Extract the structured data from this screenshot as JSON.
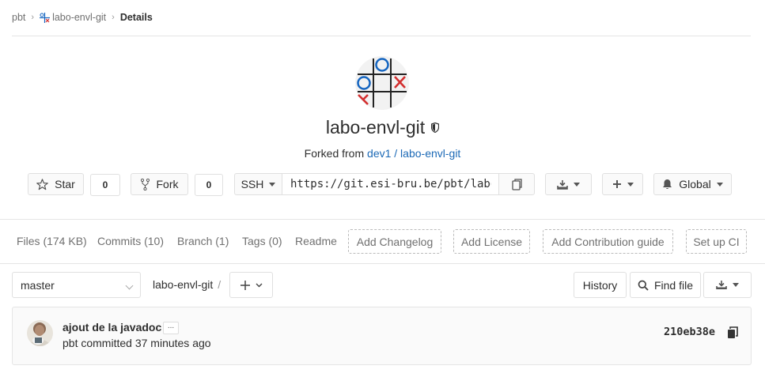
{
  "breadcrumb": {
    "group": "pbt",
    "project": "labo-envl-git",
    "current": "Details"
  },
  "project": {
    "name": "labo-envl-git",
    "forked_prefix": "Forked from ",
    "forked_from": "dev1 / labo-envl-git"
  },
  "actions": {
    "star_label": "Star",
    "star_count": "0",
    "fork_label": "Fork",
    "fork_count": "0",
    "protocol": "SSH",
    "clone_url": "https://git.esi-bru.be/pbt/labo-envl-git.git",
    "notification_label": "Global"
  },
  "nav": {
    "files": "Files (174 KB)",
    "commits": "Commits (10)",
    "branch": "Branch (1)",
    "tags": "Tags (0)",
    "readme": "Readme",
    "add_changelog": "Add Changelog",
    "add_license": "Add License",
    "add_contribution": "Add Contribution guide",
    "setup_ci": "Set up CI"
  },
  "tree": {
    "branch": "master",
    "path_root": "labo-envl-git",
    "path_sep": "/",
    "history_label": "History",
    "find_file_label": "Find file"
  },
  "commit": {
    "title": "ajout de la javadoc",
    "ellipsis": "...",
    "author": "pbt",
    "committed_text": "committed",
    "time": "37 minutes ago",
    "sha": "210eb38e"
  },
  "colors": {
    "link": "#1b69b6",
    "logo_blue": "#1565c0",
    "logo_red": "#d32f2f",
    "border": "#e0e0e0"
  }
}
